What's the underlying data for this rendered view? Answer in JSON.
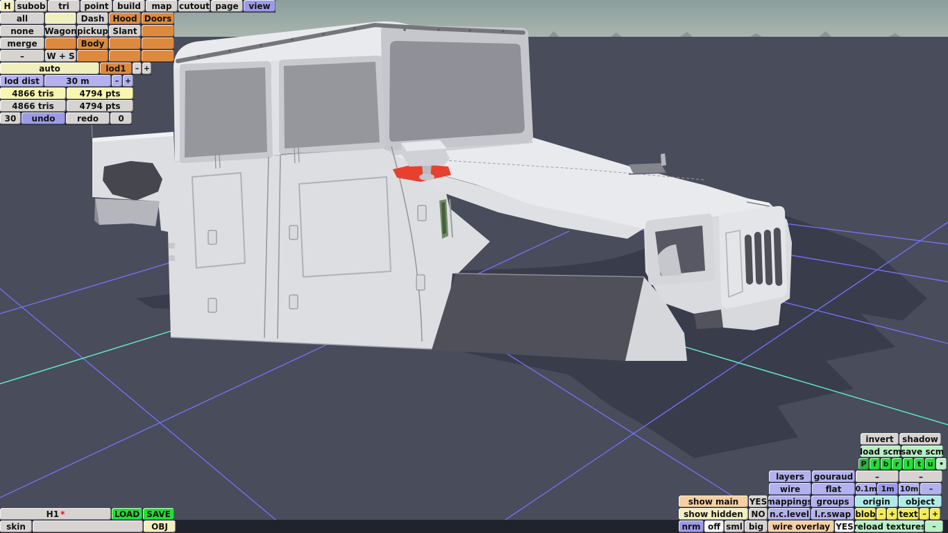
{
  "tabs": {
    "items": [
      "H",
      "subob",
      "tri",
      "point",
      "build",
      "map",
      "cutout",
      "page",
      "view"
    ],
    "active": "view"
  },
  "sel": {
    "items": [
      "all",
      "none",
      "merge",
      "–"
    ]
  },
  "parts": {
    "r1": [
      "",
      "Dash",
      "Hood",
      "Doors"
    ],
    "r2": [
      "Wagon",
      "pickup",
      "Slant",
      ""
    ],
    "r3": [
      "",
      "Body",
      "",
      ""
    ],
    "r4": [
      "W + S",
      "",
      "",
      ""
    ]
  },
  "lod": {
    "auto": "auto",
    "name": "lod1",
    "dec": "–",
    "inc": "+",
    "dist_label": "lod dist",
    "dist_value": "30 m",
    "dist_dec": "–",
    "dist_inc": "+"
  },
  "stats": {
    "tris_a": "4866 tris",
    "pts_a": "4794 pts",
    "tris_b": "4866 tris",
    "pts_b": "4794 pts"
  },
  "history": {
    "undo_count": "30",
    "undo": "undo",
    "redo": "redo",
    "redo_count": "0"
  },
  "file": {
    "name": "H1",
    "modified": "*",
    "load": "LOAD",
    "save": "SAVE",
    "skin": "skin",
    "format": "OBJ"
  },
  "panel": {
    "invert": "invert",
    "shadow": "shadow",
    "load_scm": "load scm",
    "save_scm": "save scm",
    "views": [
      "P",
      "f",
      "b",
      "r",
      "l",
      "t",
      "u"
    ],
    "dot": "•",
    "layers": "layers",
    "gouraud": "gouraud",
    "wire": "wire",
    "flat": "flat",
    "mappings": "mappings",
    "groups": "groups",
    "ncLevel": "n.c.level",
    "lrSwap": "l.r.swap",
    "dash1": "–",
    "dash2": "–",
    "steps": [
      "0.1m",
      "1m",
      "10m",
      "–"
    ],
    "origin": "origin",
    "object": "object",
    "blob": "blob",
    "blob_dec": "–",
    "blob_inc": "+",
    "text": "text",
    "text_dec": "–",
    "text_inc": "+",
    "show_main": "show main",
    "show_main_value": "YES",
    "show_hidden": "show hidden",
    "show_hidden_value": "NO",
    "nrm": "nrm",
    "nrm_off": "off",
    "nrm_sml": "sml",
    "nrm_big": "big",
    "wire_overlay": "wire overlay",
    "wire_overlay_value": "YES",
    "reload": "reload textures",
    "reload_dec": "–"
  },
  "colors": {
    "accent_orange": "#de8a3e",
    "accent_purple": "#a3a2e8",
    "accent_yellow": "#f2efbe",
    "accent_green": "#1ee232",
    "grid_line": "#7170f0",
    "grid_accent": "#60e8cd",
    "sky": "#97a8a4",
    "ground": "#494c5a",
    "shadow": "#393c4b",
    "model": "#e8e9ec",
    "marker_red": "#e8402e"
  }
}
